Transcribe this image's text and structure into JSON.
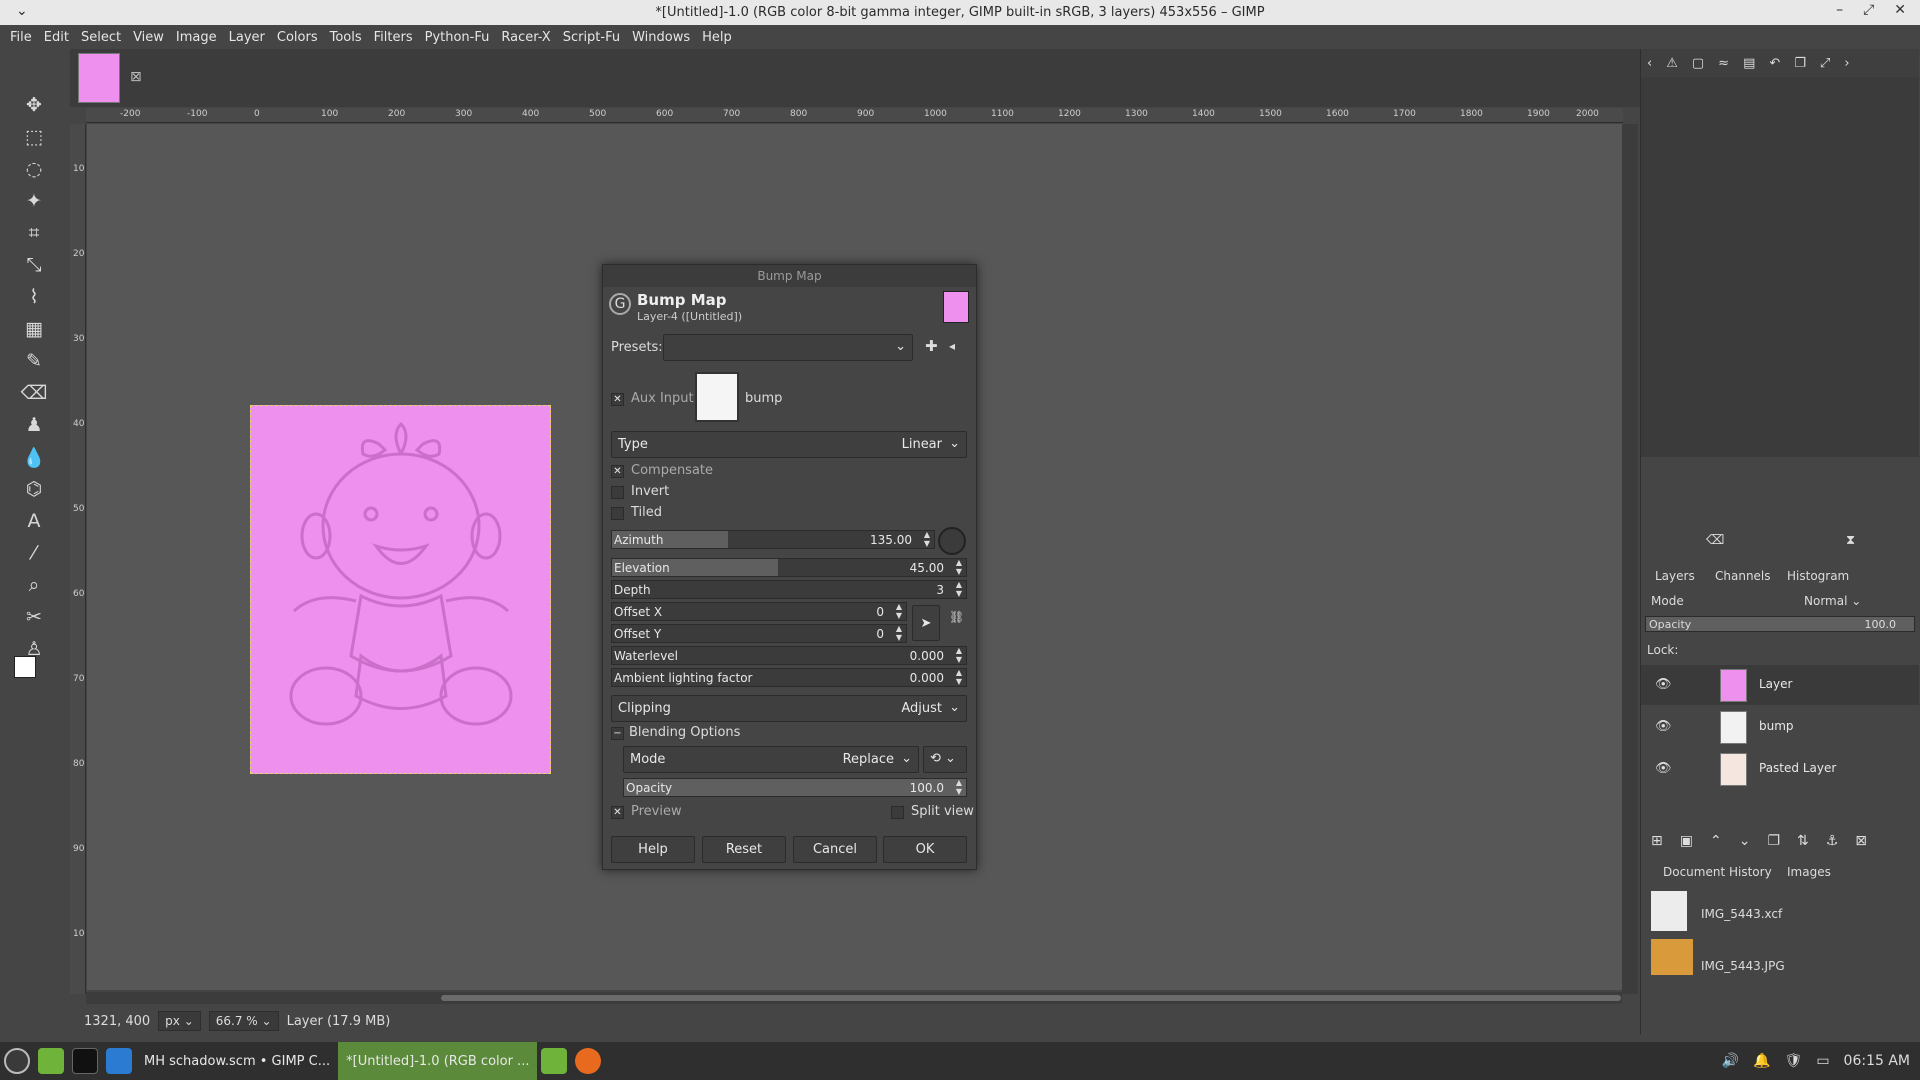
{
  "window": {
    "title": "*[Untitled]-1.0 (RGB color 8-bit gamma integer, GIMP built-in sRGB, 3 layers) 453x556 – GIMP"
  },
  "menu": [
    "File",
    "Edit",
    "Select",
    "View",
    "Image",
    "Layer",
    "Colors",
    "Tools",
    "Filters",
    "Python-Fu",
    "Racer-X",
    "Script-Fu",
    "Windows",
    "Help"
  ],
  "ruler": {
    "h_labels": [
      "-200",
      "-100",
      "0",
      "100",
      "200",
      "300",
      "400",
      "500",
      "600",
      "700",
      "800",
      "900",
      "1000",
      "1100",
      "1200",
      "1300",
      "1400",
      "1500",
      "1600",
      "1700",
      "1800",
      "1900",
      "2000"
    ],
    "v_labels": [
      "100",
      "200",
      "300",
      "400",
      "500",
      "600",
      "700",
      "800",
      "900",
      "1000"
    ]
  },
  "dialog": {
    "window_title": "Bump Map",
    "title": "Bump Map",
    "subtitle": "Layer-4 ([Untitled])",
    "presets_label": "Presets:",
    "aux_input_label": "Aux Input",
    "aux_input_value": "bump",
    "type_label": "Type",
    "type_value": "Linear",
    "compensate": "Compensate",
    "invert": "Invert",
    "tiled": "Tiled",
    "fields": {
      "azimuth": {
        "label": "Azimuth",
        "value": "135.00",
        "fraction": 0.36
      },
      "elevation": {
        "label": "Elevation",
        "value": "45.00",
        "fraction": 0.47
      },
      "depth": {
        "label": "Depth",
        "value": "3"
      },
      "offset_x": {
        "label": "Offset X",
        "value": "0"
      },
      "offset_y": {
        "label": "Offset Y",
        "value": "0"
      },
      "waterlevel": {
        "label": "Waterlevel",
        "value": "0.000"
      },
      "ambient": {
        "label": "Ambient lighting factor",
        "value": "0.000"
      }
    },
    "clipping_label": "Clipping",
    "clipping_value": "Adjust",
    "blending_label": "Blending Options",
    "mode_label": "Mode",
    "mode_value": "Replace",
    "opacity_label": "Opacity",
    "opacity_value": "100.0",
    "preview": "Preview",
    "split_view": "Split view",
    "buttons": {
      "help": "Help",
      "reset": "Reset",
      "cancel": "Cancel",
      "ok": "OK"
    }
  },
  "status": {
    "coords": "1321, 400",
    "unit": "px",
    "zoom": "66.7 %",
    "layer_info": "Layer (17.9 MB)"
  },
  "layers_panel": {
    "tabs": [
      "Layers",
      "Channels",
      "Histogram"
    ],
    "mode_label": "Mode",
    "mode_value": "Normal",
    "opacity_label": "Opacity",
    "opacity_value": "100.0",
    "lock_label": "Lock:",
    "layers": [
      {
        "name": "Layer"
      },
      {
        "name": "bump"
      },
      {
        "name": "Pasted Layer"
      }
    ]
  },
  "images_panel": {
    "tabs": [
      "Document History",
      "Images"
    ],
    "items": [
      {
        "name": "IMG_5443.xcf"
      },
      {
        "name": "IMG_5443.JPG"
      }
    ]
  },
  "taskbar": {
    "items": [
      "MH schadow.scm • GIMP C...",
      "*[Untitled]-1.0 (RGB color ..."
    ],
    "clock": "06:15 AM"
  },
  "colors": {
    "image_fill": "#ee90ee",
    "accent": "#ee90ee"
  }
}
